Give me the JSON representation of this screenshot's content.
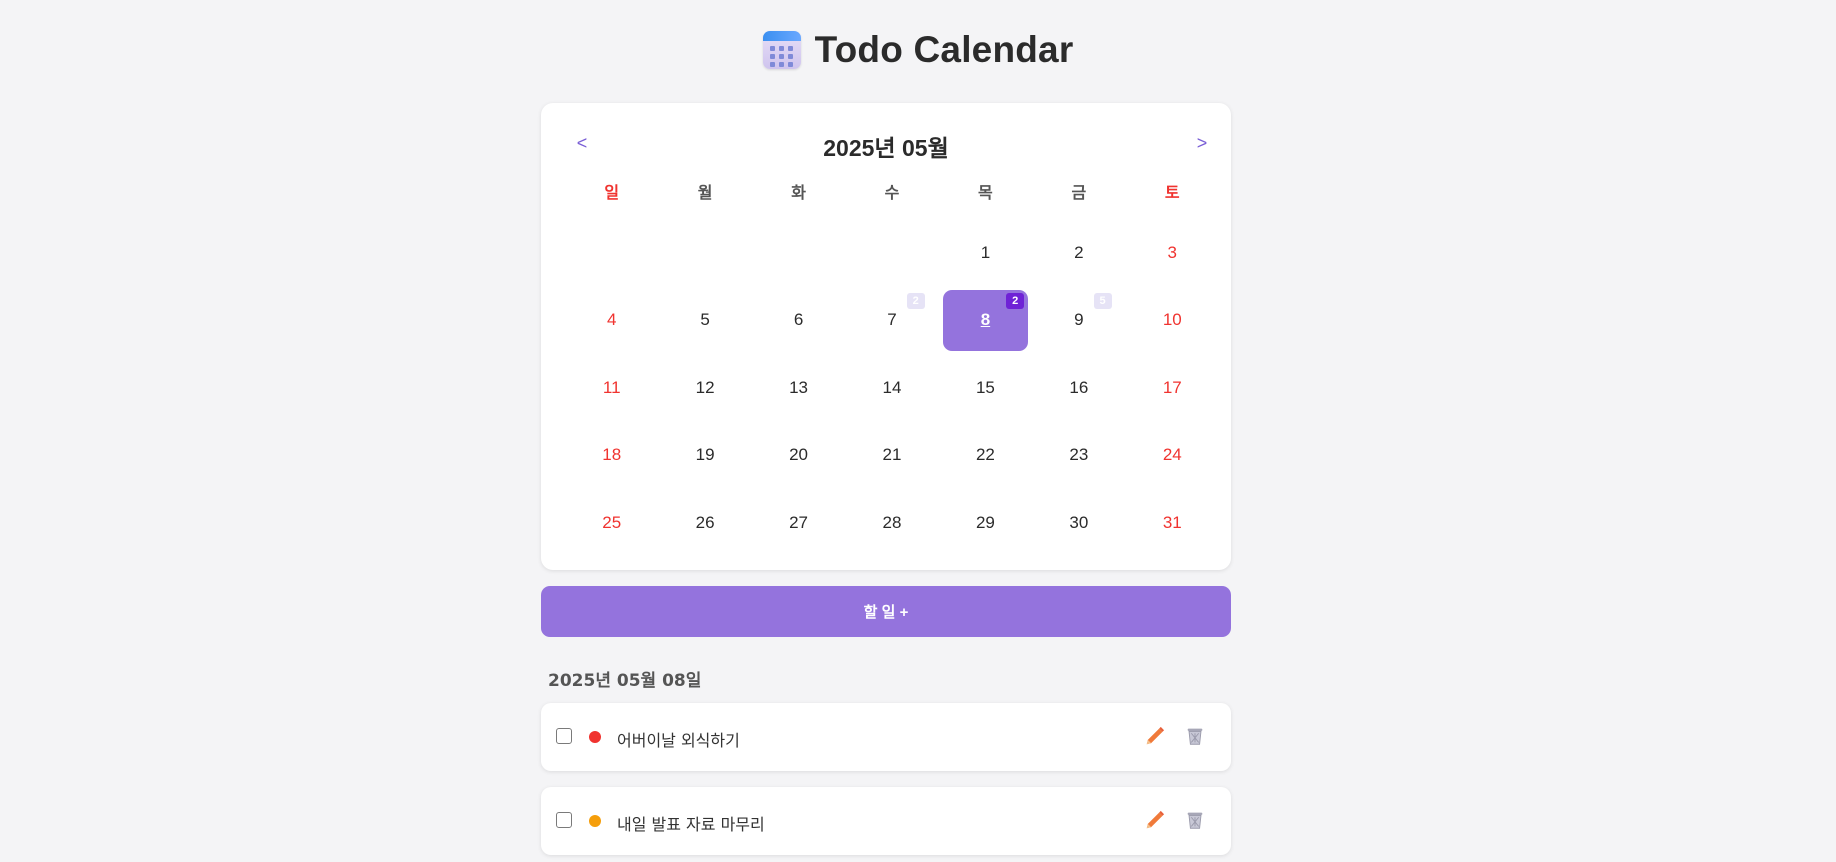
{
  "header": {
    "title": "Todo Calendar",
    "icon": "calendar-icon"
  },
  "calendar": {
    "month_label": "2025년 05월",
    "prev_label": "<",
    "next_label": ">",
    "weekdays": [
      "일",
      "월",
      "화",
      "수",
      "목",
      "금",
      "토"
    ],
    "selected_day": "8",
    "days": [
      "1",
      "2",
      "3",
      "4",
      "5",
      "6",
      "7",
      "8",
      "9",
      "10",
      "11",
      "12",
      "13",
      "14",
      "15",
      "16",
      "17",
      "18",
      "19",
      "20",
      "21",
      "22",
      "23",
      "24",
      "25",
      "26",
      "27",
      "28",
      "29",
      "30",
      "31"
    ],
    "badges": {
      "day7": "2",
      "day8": "2",
      "day9": "5"
    },
    "colors": {
      "accent": "#9473dd",
      "weekend": "#f0332f",
      "selected_badge": "#6f22d6"
    }
  },
  "actions": {
    "add_label": "할 일 +"
  },
  "todo_section": {
    "date_heading": "2025년 05월 08일",
    "items": [
      {
        "text": "어버이날 외식하기",
        "priority_color": "#f0332f",
        "checked": false
      },
      {
        "text": "내일 발표 자료 마무리",
        "priority_color": "#f59e0b",
        "checked": false
      }
    ],
    "edit_icon": "pencil-icon",
    "delete_icon": "trash-icon"
  }
}
